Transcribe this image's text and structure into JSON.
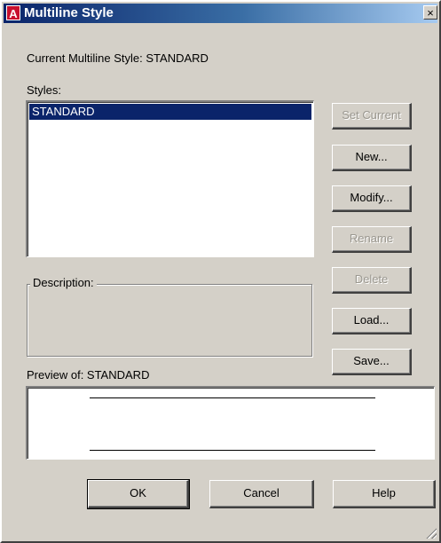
{
  "window": {
    "title": "Multiline Style",
    "icon_letter": "A",
    "close_glyph": "×"
  },
  "current_style_label": "Current Multiline Style: STANDARD",
  "styles": {
    "label": "Styles:",
    "items": [
      "STANDARD"
    ],
    "selected": "STANDARD"
  },
  "description": {
    "label": "Description:",
    "value": ""
  },
  "preview": {
    "label": "Preview of: STANDARD"
  },
  "side_buttons": {
    "set_current": "Set Current",
    "new": "New...",
    "modify": "Modify...",
    "rename": "Rename",
    "delete": "Delete",
    "load": "Load...",
    "save": "Save..."
  },
  "bottom_buttons": {
    "ok": "OK",
    "cancel": "Cancel",
    "help": "Help"
  },
  "colors": {
    "face": "#d4d0c8",
    "selection": "#0a246a",
    "title_gradient_start": "#0a246a",
    "title_gradient_end": "#a6caf0"
  }
}
